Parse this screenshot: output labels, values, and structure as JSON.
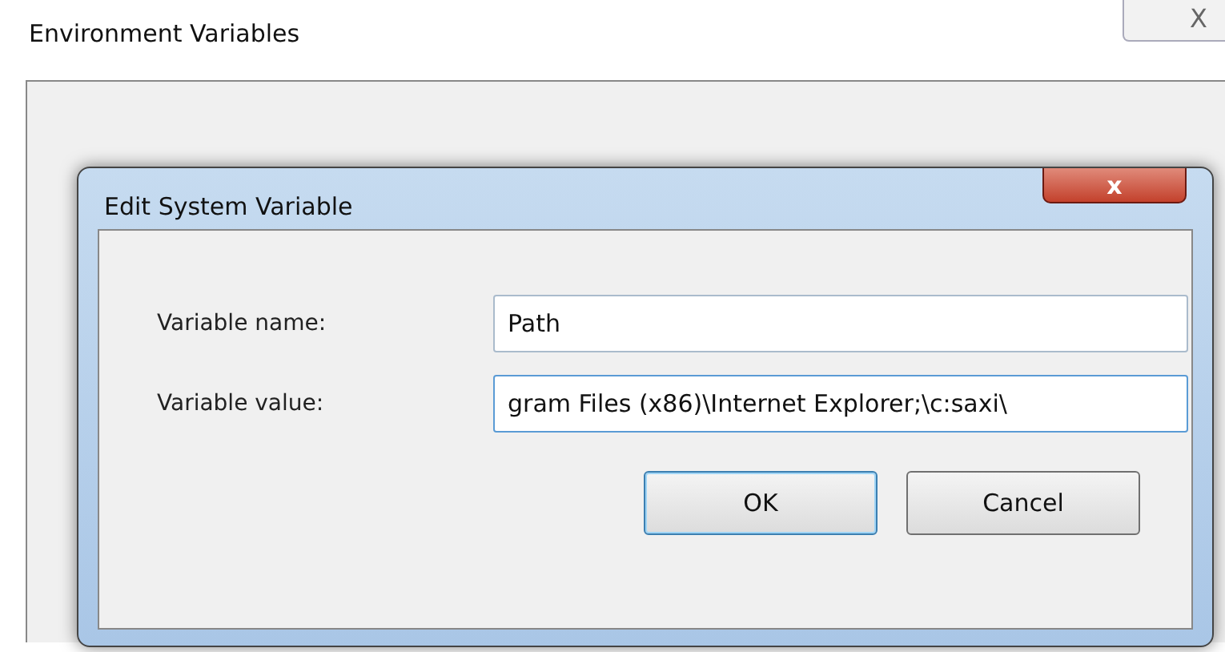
{
  "window": {
    "title": "Environment Variables",
    "close": "X"
  },
  "dialog": {
    "title": "Edit System Variable",
    "close": "x",
    "fields": [
      {
        "label": "Variable name:",
        "value": "Path",
        "focused": false
      },
      {
        "label": "Variable value:",
        "value": "gram Files (x86)\\Internet Explorer;\\c:saxi\\",
        "focused": true
      }
    ],
    "buttons": [
      {
        "label": "OK",
        "default": true
      },
      {
        "label": "Cancel",
        "default": false
      }
    ]
  }
}
